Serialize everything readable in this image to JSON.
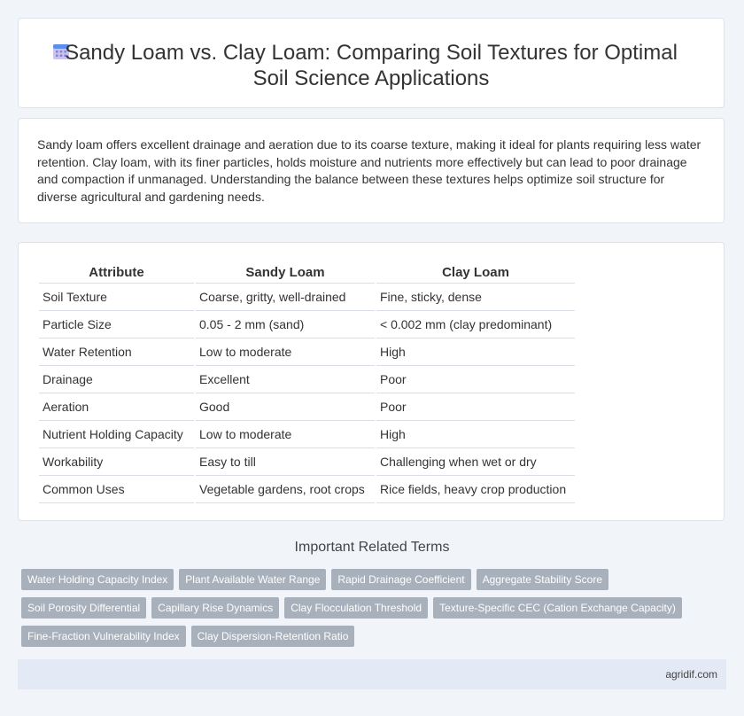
{
  "header": {
    "title": "Sandy Loam vs. Clay Loam: Comparing Soil Textures for Optimal Soil Science Applications",
    "icon": "calendar-icon"
  },
  "intro": {
    "text": "Sandy loam offers excellent drainage and aeration due to its coarse texture, making it ideal for plants requiring less water retention. Clay loam, with its finer particles, holds moisture and nutrients more effectively but can lead to poor drainage and compaction if unmanaged. Understanding the balance between these textures helps optimize soil structure for diverse agricultural and gardening needs."
  },
  "table": {
    "headers": [
      "Attribute",
      "Sandy Loam",
      "Clay Loam"
    ],
    "rows": [
      [
        "Soil Texture",
        "Coarse, gritty, well-drained",
        "Fine, sticky, dense"
      ],
      [
        "Particle Size",
        "0.05 - 2 mm (sand)",
        "< 0.002 mm (clay predominant)"
      ],
      [
        "Water Retention",
        "Low to moderate",
        "High"
      ],
      [
        "Drainage",
        "Excellent",
        "Poor"
      ],
      [
        "Aeration",
        "Good",
        "Poor"
      ],
      [
        "Nutrient Holding Capacity",
        "Low to moderate",
        "High"
      ],
      [
        "Workability",
        "Easy to till",
        "Challenging when wet or dry"
      ],
      [
        "Common Uses",
        "Vegetable gardens, root crops",
        "Rice fields, heavy crop production"
      ]
    ]
  },
  "related": {
    "title": "Important Related Terms",
    "tags": [
      [
        "Water Holding Capacity Index",
        "Plant Available Water Range",
        "Rapid Drainage Coefficient",
        "Aggregate Stability Score"
      ],
      [
        "Soil Porosity Differential",
        "Capillary Rise Dynamics",
        "Clay Flocculation Threshold",
        "Texture-Specific CEC (Cation Exchange Capacity)"
      ],
      [
        "Fine-Fraction Vulnerability Index",
        "Clay Dispersion-Retention Ratio"
      ]
    ]
  },
  "footer": {
    "site": "agridif.com"
  },
  "colors": {
    "background": "#f1f4f9",
    "tag_bg": "#a8b0bb",
    "footer_bg": "#e3eaf5"
  }
}
